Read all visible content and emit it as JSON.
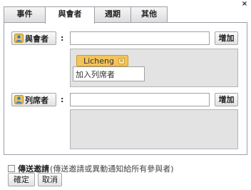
{
  "dialog": {
    "close_glyph": "×"
  },
  "tabs": [
    {
      "label": "事件"
    },
    {
      "label": "與會者",
      "active": true
    },
    {
      "label": "週期"
    },
    {
      "label": "其他"
    }
  ],
  "attendees": {
    "button_label": "與會者",
    "colon": ":",
    "input_value": "",
    "add_label": "增加",
    "chips": [
      {
        "label": "Licheng"
      }
    ],
    "chip_input_placeholder": "加入列席者"
  },
  "observers": {
    "button_label": "列席者",
    "colon": ":",
    "input_value": "",
    "add_label": "增加"
  },
  "invite": {
    "checked": false,
    "label": "傳送邀請",
    "note": "(傳送邀請或異動通知給所有參與者)"
  },
  "footer": {
    "ok_label": "確定",
    "cancel_label": "取消"
  },
  "icons": {
    "person": "person-icon"
  },
  "colors": {
    "chip_bg": "#f4c35a",
    "panel_border": "#9aa0a8",
    "list_bg": "#e3e3e3"
  }
}
